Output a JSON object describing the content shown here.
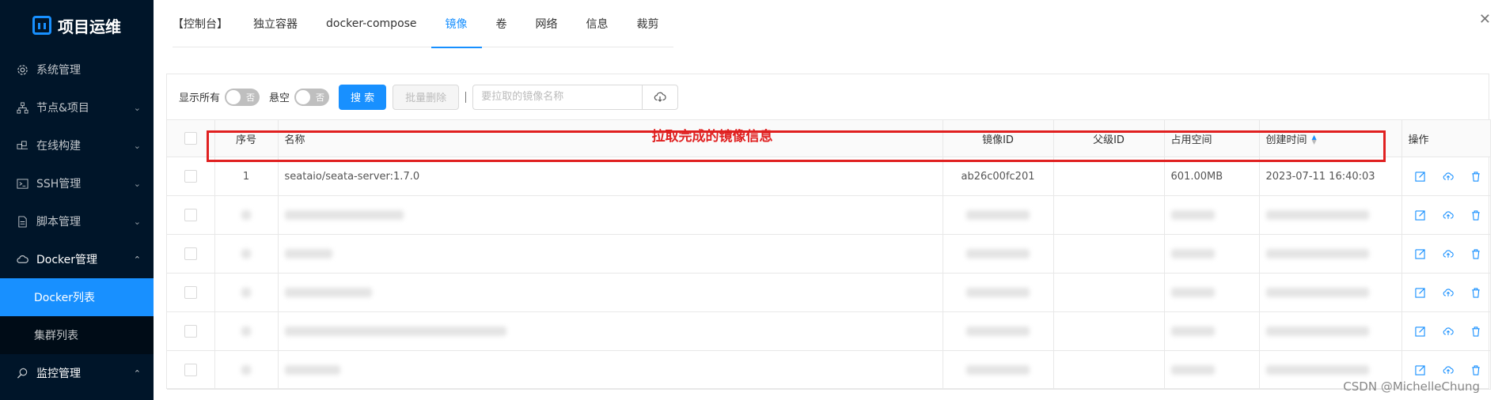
{
  "sidebar": {
    "logo": "项目运维",
    "items": [
      {
        "label": "系统管理",
        "icon": "gear-icon",
        "chevron": false
      },
      {
        "label": "节点&项目",
        "icon": "sitemap-icon",
        "chevron": "down"
      },
      {
        "label": "在线构建",
        "icon": "build-icon",
        "chevron": "down"
      },
      {
        "label": "SSH管理",
        "icon": "terminal-icon",
        "chevron": "down"
      },
      {
        "label": "脚本管理",
        "icon": "file-icon",
        "chevron": "down"
      },
      {
        "label": "Docker管理",
        "icon": "cloud-icon",
        "chevron": "up"
      }
    ],
    "subitems": [
      {
        "label": "Docker列表",
        "active": true
      },
      {
        "label": "集群列表",
        "active": false
      }
    ],
    "bottom_item": {
      "label": "监控管理",
      "icon": "search-icon",
      "chevron": "up"
    }
  },
  "tabs": {
    "console": "【控制台】",
    "items": [
      "独立容器",
      "docker-compose",
      "镜像",
      "卷",
      "网络",
      "信息",
      "裁剪"
    ],
    "active": "镜像"
  },
  "toolbar": {
    "show_all_label": "显示所有",
    "show_all_toggle": "否",
    "dangling_label": "悬空",
    "dangling_toggle": "否",
    "search_button": "搜 索",
    "batch_delete_button": "批量删除",
    "pull_placeholder": "要拉取的镜像名称"
  },
  "table": {
    "headers": {
      "index": "序号",
      "name": "名称",
      "image_id": "镜像ID",
      "parent_id": "父级ID",
      "size": "占用空间",
      "created": "创建时间",
      "actions": "操作"
    },
    "rows": [
      {
        "index": "1",
        "name": "seataio/seata-server:1.7.0",
        "image_id": "ab26c00fc201",
        "parent_id": "",
        "size": "601.00MB",
        "created": "2023-07-11 16:40:03"
      }
    ],
    "blurred_row_count_visible": 5
  },
  "annotation": "拉取完成的镜像信息",
  "watermark": "CSDN @MichelleChung",
  "colors": {
    "sidebar_bg": "#001529",
    "accent": "#1890ff",
    "annotation": "#e02020"
  }
}
